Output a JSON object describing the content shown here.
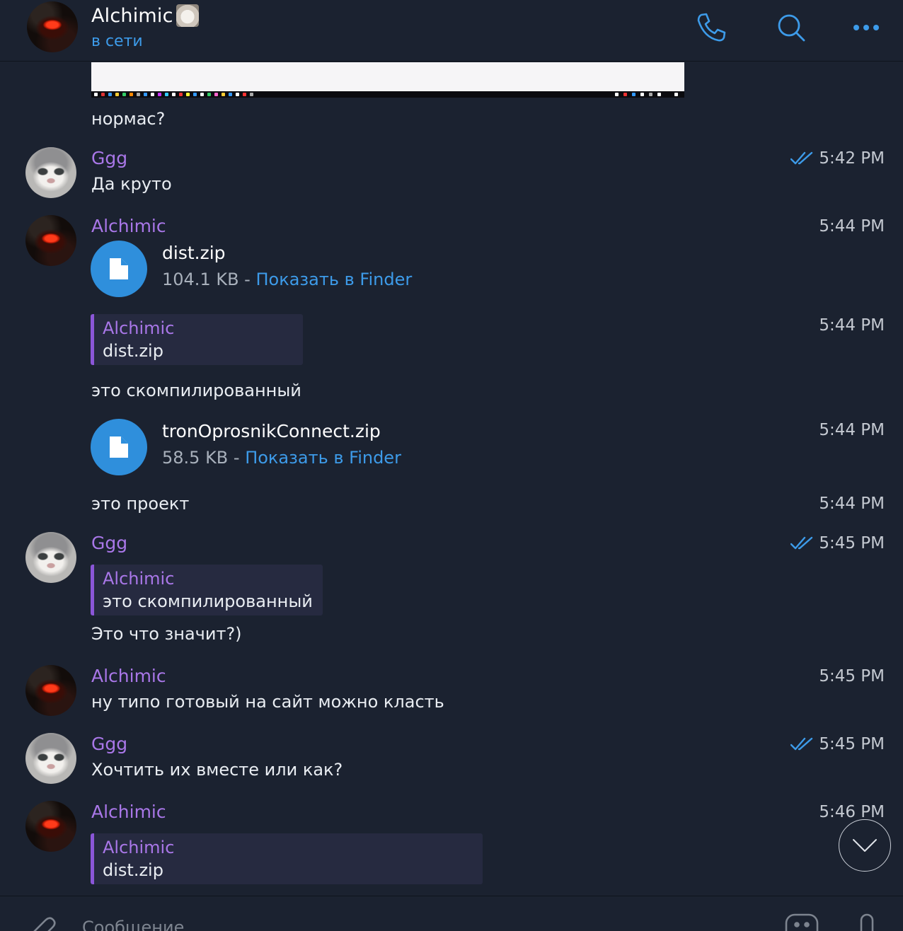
{
  "header": {
    "title": "Alchimic",
    "status": "в сети"
  },
  "messages": {
    "m0_text": "нормас?",
    "m1_sender": "Ggg",
    "m1_time": "5:42 PM",
    "m1_text": "Да круто",
    "m2_sender": "Alchimic",
    "m2_time": "5:44 PM",
    "m2_file_name": "dist.zip",
    "m2_file_size": "104.1 KB",
    "m2_sep": " - ",
    "m2_finder": "Показать в Finder",
    "m3_time": "5:44 PM",
    "m3_reply_name": "Alchimic",
    "m3_reply_text": "dist.zip",
    "m3_text": "это скомпилированный",
    "m4_time": "5:44 PM",
    "m4_file_name": "tronOprosnikConnect.zip",
    "m4_file_size": "58.5 KB",
    "m4_sep": " - ",
    "m4_finder": "Показать в Finder",
    "m5_time": "5:44 PM",
    "m5_text": "это проект",
    "m6_sender": "Ggg",
    "m6_time": "5:45 PM",
    "m6_reply_name": "Alchimic",
    "m6_reply_text": "это скомпилированный",
    "m6_text": "Это что значит?)",
    "m7_sender": "Alchimic",
    "m7_time": "5:45 PM",
    "m7_text": "ну типо готовый на сайт можно класть",
    "m8_sender": "Ggg",
    "m8_time": "5:45 PM",
    "m8_text": "Хочтить их вместе или как?",
    "m9_sender": "Alchimic",
    "m9_time": "5:46 PM",
    "m9_reply_name": "Alchimic",
    "m9_reply_text": "dist.zip"
  },
  "composer": {
    "placeholder": "Сообщение"
  },
  "icons": {
    "call": "phone-icon",
    "search": "search-icon",
    "more": "more-dots-icon",
    "attach": "paperclip-icon",
    "sticker": "sticker-icon",
    "mic": "microphone-icon",
    "scroll": "chevron-down-icon",
    "file": "file-icon",
    "read": "double-check-icon"
  },
  "colors": {
    "background": "#1b2230",
    "accent": "#3d9be9",
    "sender": "#a977e8",
    "reply_bar": "#8b56d8"
  }
}
